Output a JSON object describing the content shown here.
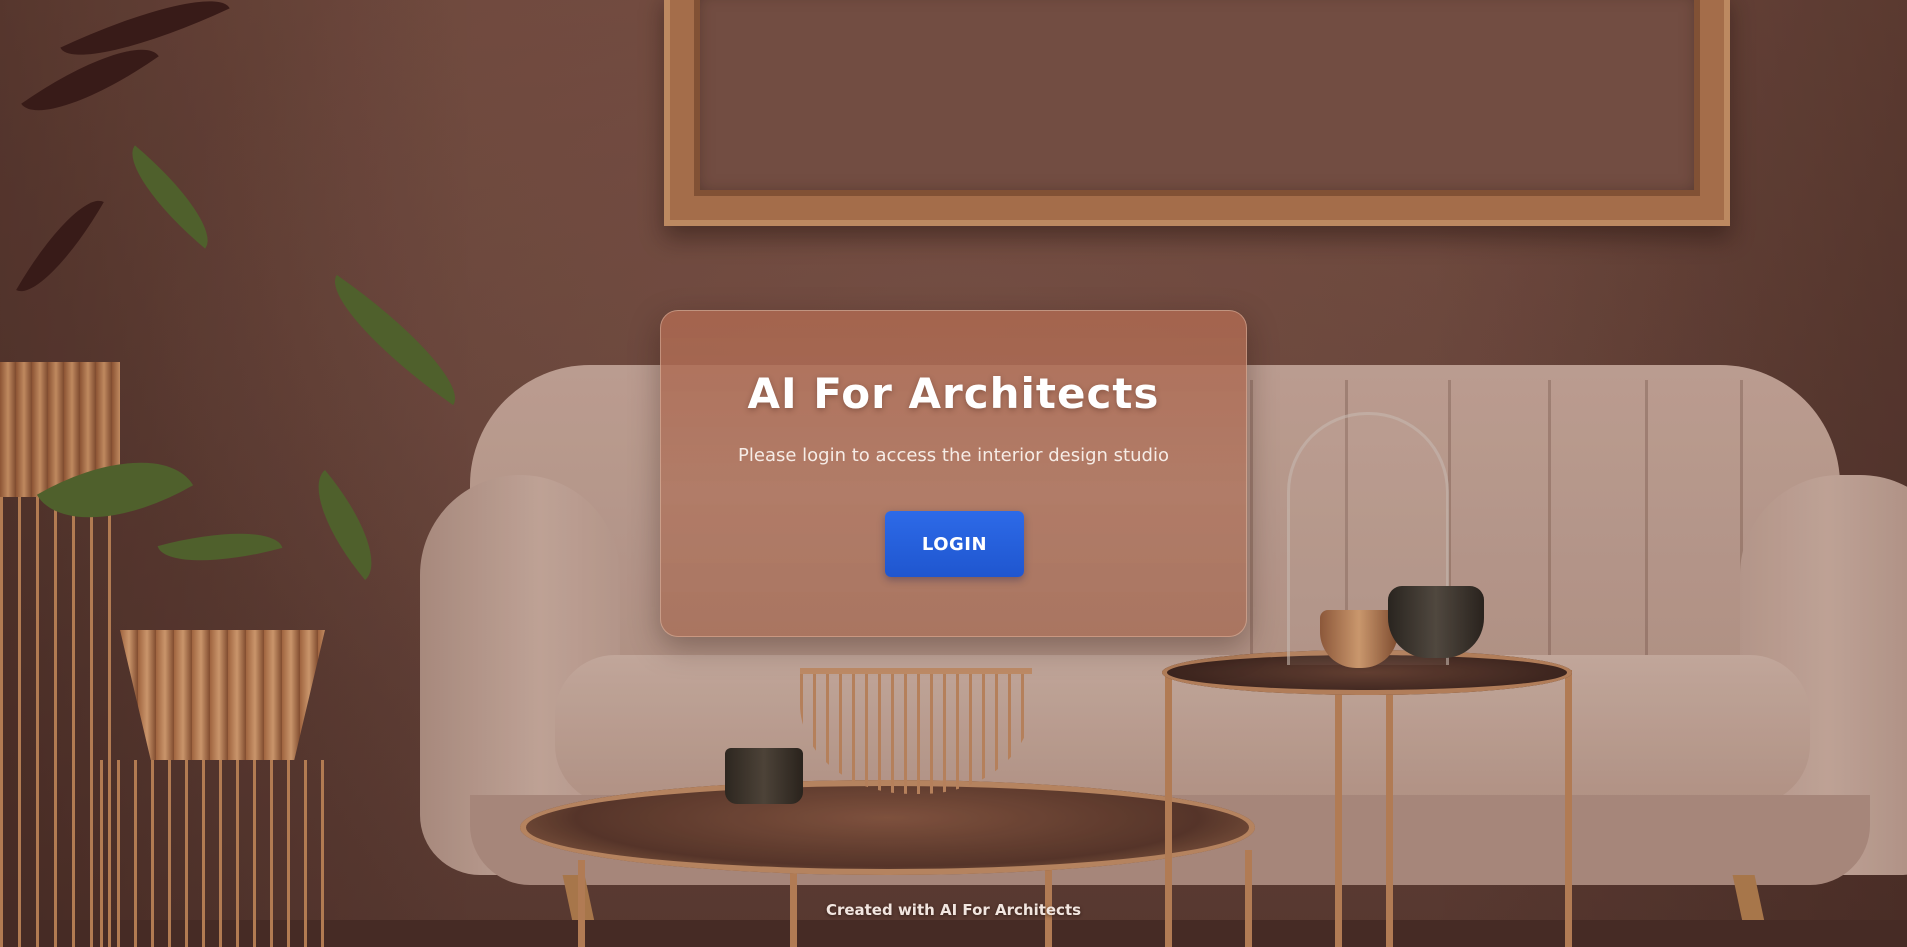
{
  "app": {
    "title": "AI For Architects",
    "subtitle": "Please login to access the interior design studio"
  },
  "login": {
    "button_label": "LOGIN",
    "button_color": "#2360de"
  },
  "footer": {
    "credit": "Created with AI For Architects"
  },
  "background": {
    "description_colors": {
      "wall": "#7a5245",
      "sofa": "#cfb0a2",
      "copper": "#c58a5c"
    }
  }
}
